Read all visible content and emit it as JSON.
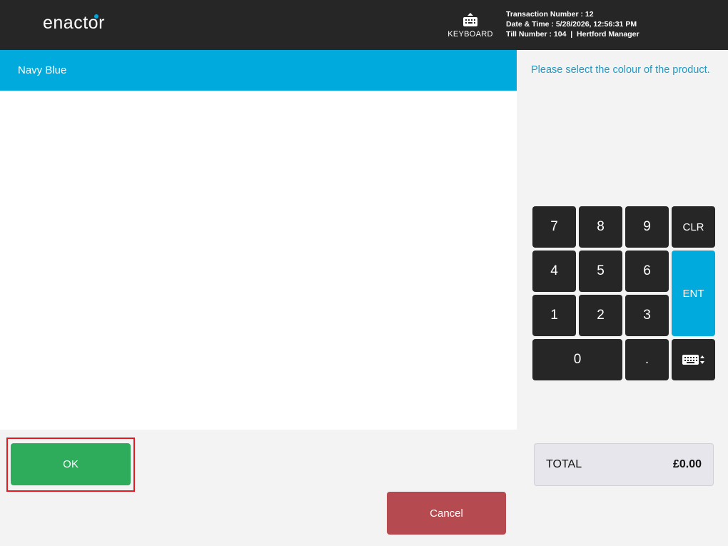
{
  "header": {
    "logo": "enactor",
    "keyboard_label": "KEYBOARD",
    "transaction_number": "Transaction Number : 12",
    "date_time": "Date & Time : 5/28/2026, 12:56:31 PM",
    "till_info": "Till Number : 104  |  Hertford Manager"
  },
  "selection": {
    "selected_value": "Navy Blue"
  },
  "prompt": "Please select the colour of the product.",
  "keypad": {
    "k7": "7",
    "k8": "8",
    "k9": "9",
    "clr": "CLR",
    "k4": "4",
    "k5": "5",
    "k6": "6",
    "ent": "ENT",
    "k1": "1",
    "k2": "2",
    "k3": "3",
    "k0": "0",
    "dot": ".",
    "keyboard_toggle_icon": "keyboard-toggle-icon"
  },
  "buttons": {
    "ok": "OK",
    "cancel": "Cancel"
  },
  "total": {
    "label": "TOTAL",
    "amount": "£0.00"
  },
  "colors": {
    "header_bg": "#262626",
    "accent": "#00aadc",
    "ok": "#2fab5c",
    "cancel": "#b54a50",
    "highlight_outline": "#e01b22"
  }
}
